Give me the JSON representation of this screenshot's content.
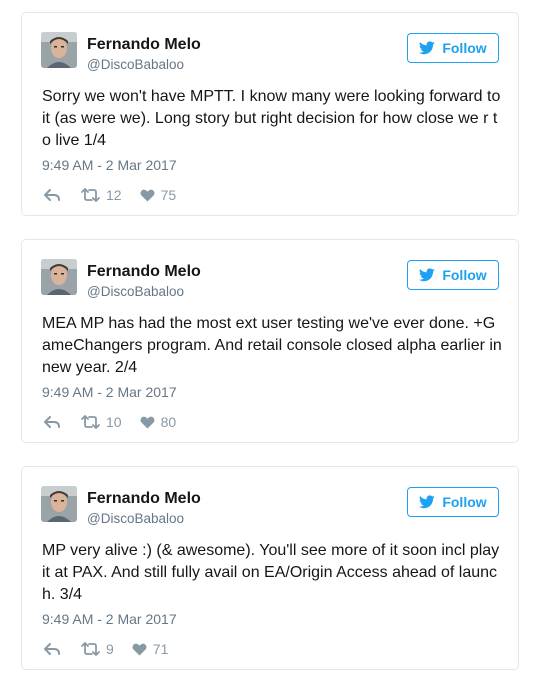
{
  "colors": {
    "accent": "#1da1f2",
    "secondary_text": "#657786",
    "icon_gray": "#8899a6",
    "border": "#e1e8ed"
  },
  "icons": {
    "follow": "twitter-bird-icon",
    "reply": "reply-icon",
    "retweet": "retweet-icon",
    "like": "heart-icon"
  },
  "tweets": [
    {
      "author_name": "Fernando Melo",
      "author_handle": "@DiscoBabaloo",
      "follow_label": "Follow",
      "text": "Sorry we won't have MPTT. I know many were looking forward to it (as were we). Long story but right decision for how close we r to live 1/4",
      "timestamp": "9:49 AM - 2 Mar 2017",
      "retweets": "12",
      "likes": "75"
    },
    {
      "author_name": "Fernando Melo",
      "author_handle": "@DiscoBabaloo",
      "follow_label": "Follow",
      "text": "MEA MP has had the most ext user testing we've ever done. +GameChangers program. And retail console closed alpha earlier in new year. 2/4",
      "timestamp": "9:49 AM - 2 Mar 2017",
      "retweets": "10",
      "likes": "80"
    },
    {
      "author_name": "Fernando Melo",
      "author_handle": "@DiscoBabaloo",
      "follow_label": "Follow",
      "text": "MP very alive :) (& awesome). You'll see more of it soon incl play it at PAX. And still fully avail on EA/Origin Access ahead of launch. 3/4",
      "timestamp": "9:49 AM - 2 Mar 2017",
      "retweets": "9",
      "likes": "71"
    }
  ]
}
